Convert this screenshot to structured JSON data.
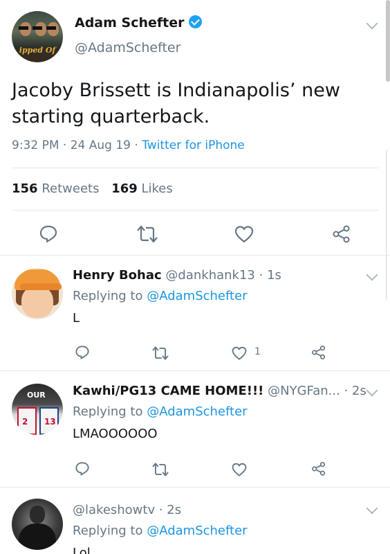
{
  "main_tweet": {
    "author_name": "Adam Schefter",
    "handle": "@AdamSchefter",
    "avatar_caption": "ipped Of",
    "text_line1": "Jacoby Brissett is Indianapolis’ new",
    "text_line2": "starting quarterback.",
    "time": "9:32 PM",
    "date": "24 Aug 19",
    "source": "Twitter for iPhone",
    "retweets_count": "156",
    "retweets_label": "Retweets",
    "likes_count": "169",
    "likes_label": "Likes"
  },
  "replies": [
    {
      "name": "Henry Bohac",
      "handle": "@dankhank13",
      "time": "1s",
      "replying_label": "Replying to",
      "replying_to": "@AdamSchefter",
      "text": "L",
      "like_count": "1"
    },
    {
      "name": "Kawhi/PG13 CAME HOME!!!",
      "handle": "@NYGFan...",
      "time": "2s",
      "replying_label": "Replying to",
      "replying_to": "@AdamSchefter",
      "text": "LMAOOOOOO",
      "avatar_texts": [
        "OUR",
        "2",
        "13"
      ],
      "like_count": ""
    },
    {
      "name": "",
      "handle": "@lakeshowtv",
      "time": "2s",
      "replying_label": "Replying to",
      "replying_to": "@AdamSchefter",
      "text": "Lol"
    }
  ],
  "icons": [
    "verified-icon",
    "reply-icon",
    "retweet-icon",
    "like-icon",
    "share-icon",
    "chevron-down-icon"
  ],
  "colors": {
    "link": "#1b95e0",
    "verified": "#1da1f2",
    "muted": "#657786",
    "text": "#14171a"
  }
}
